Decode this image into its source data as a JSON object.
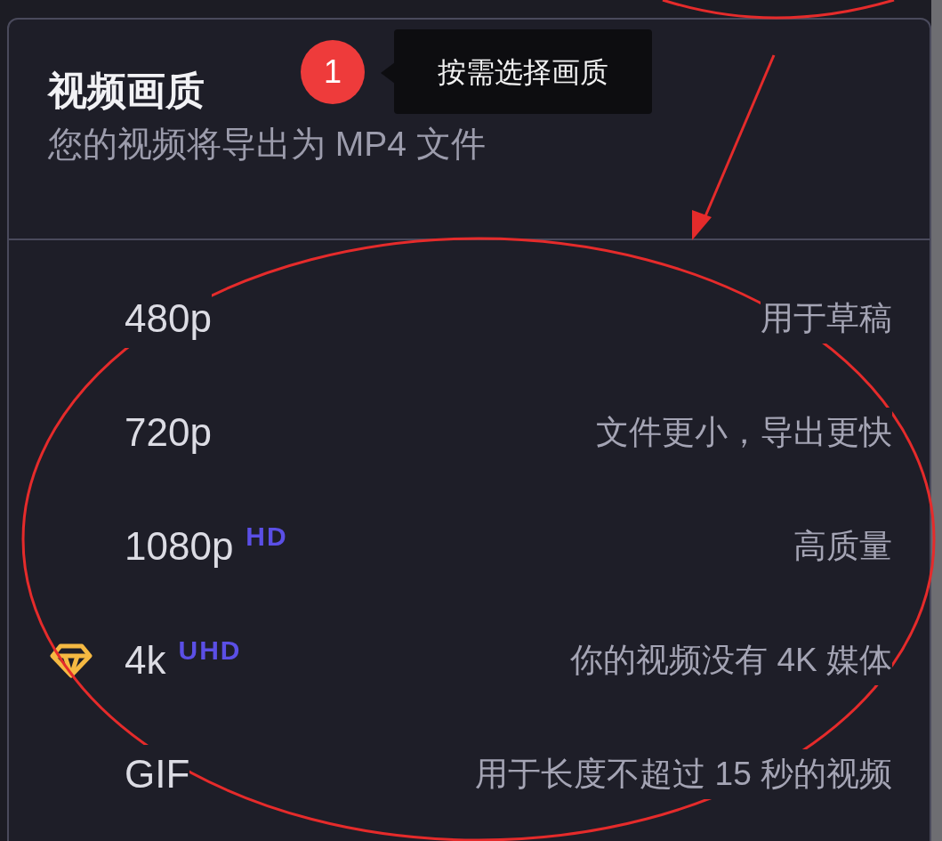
{
  "panel": {
    "title": "视频画质",
    "subtitle": "您的视频将导出为 MP4 文件"
  },
  "annotation": {
    "number": "1",
    "tooltip": "按需选择画质"
  },
  "options": [
    {
      "label": "480p",
      "description": "用于草稿",
      "premium": false
    },
    {
      "label": "720p",
      "description": "文件更小，导出更快",
      "premium": false
    },
    {
      "label": "1080p",
      "badge": "HD",
      "description": "高质量",
      "premium": false
    },
    {
      "label": "4k",
      "badge": "UHD",
      "description": "你的视频没有 4K 媒体",
      "premium": true
    },
    {
      "label": "GIF",
      "description": "用于长度不超过 15 秒的视频",
      "premium": false
    }
  ]
}
